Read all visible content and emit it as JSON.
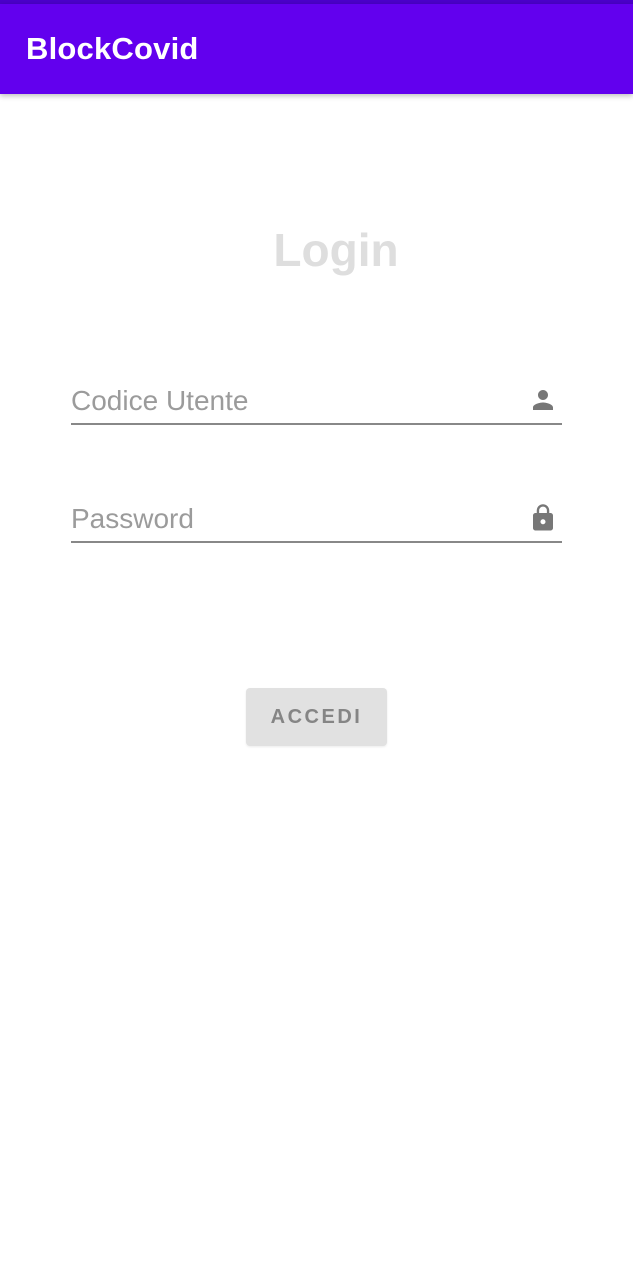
{
  "app_bar": {
    "title": "BlockCovid",
    "color": "#6200ee"
  },
  "login": {
    "title": "Login",
    "user_field": {
      "placeholder": "Codice Utente",
      "value": "",
      "icon": "person-icon"
    },
    "password_field": {
      "placeholder": "Password",
      "value": "",
      "icon": "lock-icon"
    },
    "submit_label": "ACCEDI"
  }
}
